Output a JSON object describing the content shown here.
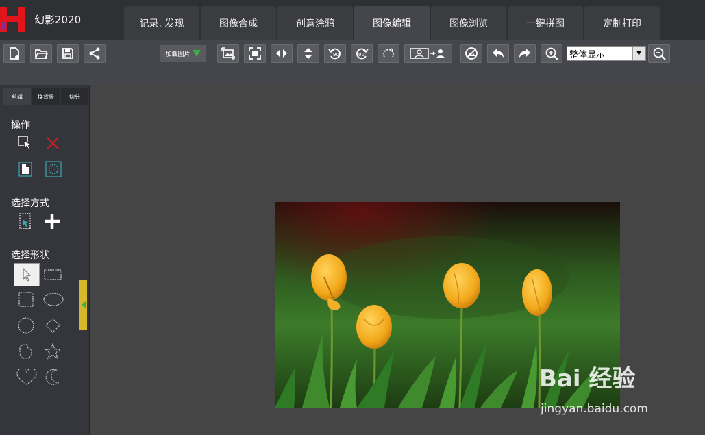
{
  "app": {
    "title": "幻影2020"
  },
  "tabs": [
    {
      "label": "记录. 发现"
    },
    {
      "label": "图像合成"
    },
    {
      "label": "创意涂鸦"
    },
    {
      "label": "图像编辑",
      "active": true
    },
    {
      "label": "图像浏览"
    },
    {
      "label": "一键拼图"
    },
    {
      "label": "定制打印"
    }
  ],
  "toolbar": {
    "load_image_label": "加载图片",
    "zoom_value": "整体显示"
  },
  "panel": {
    "tabs": [
      {
        "label": "剪辑"
      },
      {
        "label": "换背景"
      },
      {
        "label": "切分"
      }
    ],
    "section_operation": "操作",
    "section_select_mode": "选择方式",
    "section_select_shape": "选择形状"
  },
  "watermark": {
    "brand": "Bai 经验",
    "url": "jingyan.baidu.com"
  },
  "colors": {
    "accent_green": "#3fae49",
    "handle_yellow": "#d7b72c",
    "logo_red": "#e0151b"
  }
}
